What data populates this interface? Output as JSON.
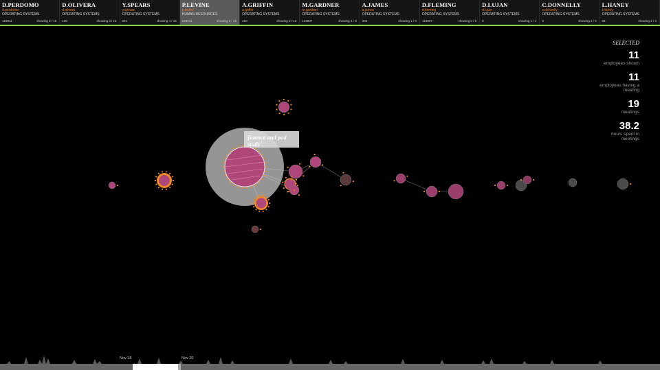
{
  "employees": [
    {
      "name": "D.PERDOMO",
      "user": "d.perdomo",
      "dept": "OPERATING SYSTEMS",
      "id": "123811",
      "showing": "showing 5 / 16",
      "selected": false
    },
    {
      "name": "D.OLIVERA",
      "user": "d.olivera",
      "dept": "OPERATING SYSTEMS",
      "id": "136",
      "showing": "showing 3 / 16",
      "selected": false
    },
    {
      "name": "Y.SPEARS",
      "user": "y.spears",
      "dept": "OPERATING SYSTEMS",
      "id": "201",
      "showing": "showing 4 / 16",
      "selected": false
    },
    {
      "name": "P.LEVINE",
      "user": "p.levine",
      "dept": "HUMAN RESOURCES",
      "id": "123811",
      "showing": "showing 8 / 15",
      "selected": true
    },
    {
      "name": "A.GRIFFIN",
      "user": "a.griffin",
      "dept": "OPERATING SYSTEMS",
      "id": "210",
      "showing": "showing 3 / 12",
      "selected": false
    },
    {
      "name": "M.GARDNER",
      "user": "m.gardner",
      "dept": "OPERATING SYSTEMS",
      "id": "123807",
      "showing": "showing 4 / 8",
      "selected": false
    },
    {
      "name": "A.JAMES",
      "user": "a.james",
      "dept": "OPERATING SYSTEMS",
      "id": "305",
      "showing": "showing 1 / 9",
      "selected": false
    },
    {
      "name": "D.FLEMING",
      "user": "d.fleming",
      "dept": "OPERATING SYSTEMS",
      "id": "123807",
      "showing": "showing 3 / 5",
      "selected": false
    },
    {
      "name": "D.LUJAN",
      "user": "d.lujan",
      "dept": "OPERATING SYSTEMS",
      "id": "8",
      "showing": "showing 1 / 4",
      "selected": false
    },
    {
      "name": "C.DONNELLY",
      "user": "c.donnelly",
      "dept": "OPERATING SYSTEMS",
      "id": "9",
      "showing": "showing 2 / 9",
      "selected": false
    },
    {
      "name": "L.HANEY",
      "user": "l.haney",
      "dept": "OPERATING SYSTEMS",
      "id": "01",
      "showing": "showing 4 / 4",
      "selected": false
    }
  ],
  "stats": {
    "heading": "SELECTED",
    "employees_shown": {
      "value": "11",
      "label": "employees shown"
    },
    "employees_meeting": {
      "value": "11",
      "label": "employees having a meeting"
    },
    "meetings": {
      "value": "19",
      "label": "meetings"
    },
    "hours": {
      "value": "38.2",
      "label": "hours spent in meetings"
    }
  },
  "tooltip": {
    "title": "finance and pod study"
  },
  "timeline": {
    "label1": "Nov 18",
    "label2": "Nov 20"
  },
  "colors": {
    "accent_green": "#8fd651",
    "meeting_fill": "#b0477a",
    "dot_orange": "#f08a24",
    "selected_tab": "#5a5a5a"
  }
}
